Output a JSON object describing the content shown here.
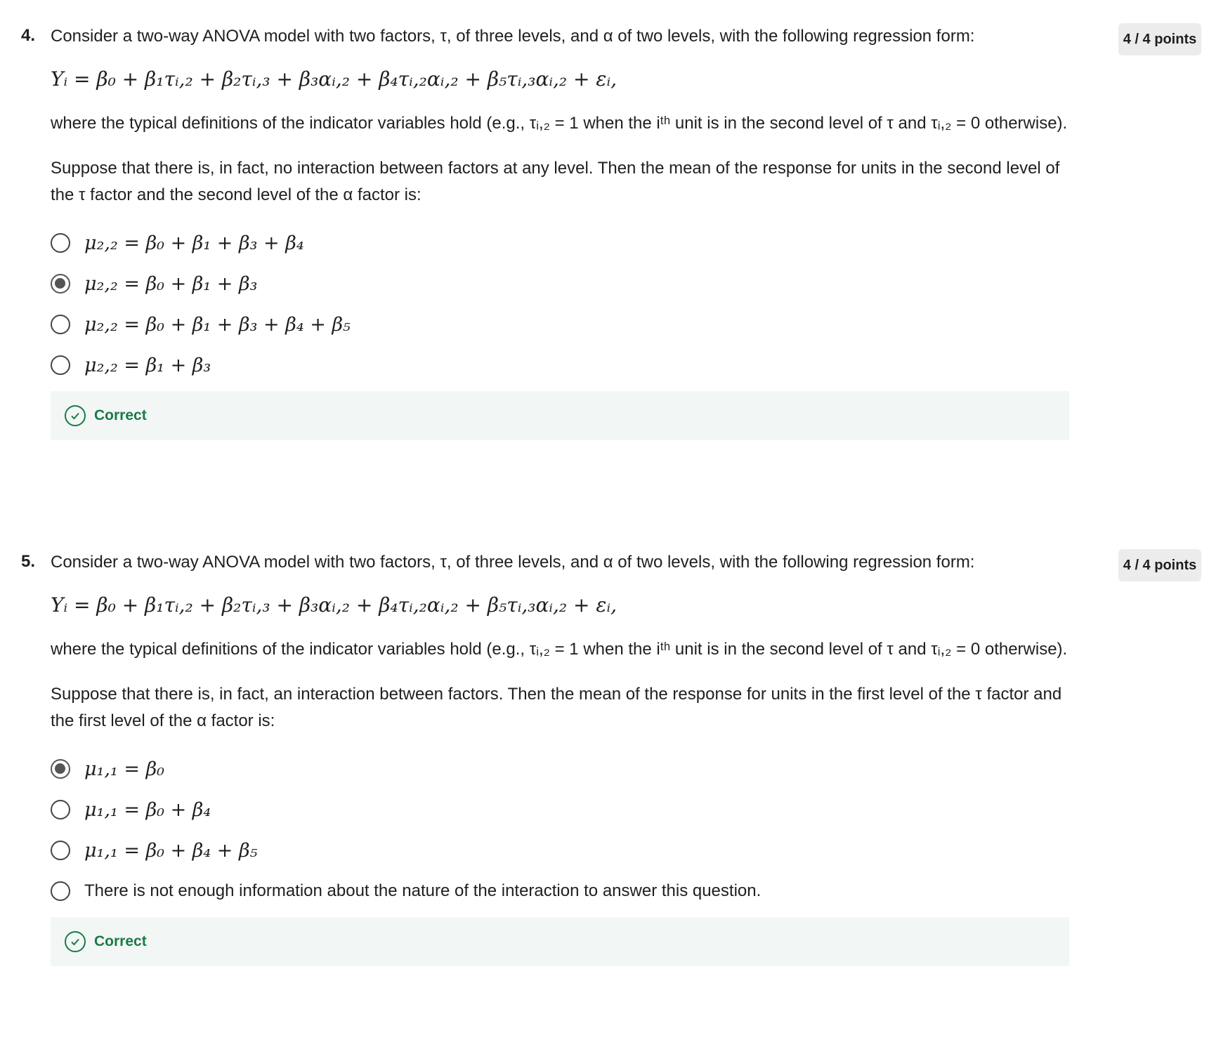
{
  "questions": [
    {
      "number": "4.",
      "points": "4 / 4 points",
      "prompt": "Consider a two-way ANOVA model with two factors, τ, of three levels, and α of two levels, with the following regression form:",
      "equation": "Yᵢ = β₀ + β₁τᵢ,₂ + β₂τᵢ,₃ + β₃αᵢ,₂ + β₄τᵢ,₂αᵢ,₂ + β₅τᵢ,₃αᵢ,₂ + εᵢ,",
      "definition": "where the typical definitions of the indicator variables hold (e.g., τᵢ,₂ = 1 when the iᵗʰ unit is in the second level of τ and τᵢ,₂ = 0 otherwise).",
      "scenario": "Suppose that there is, in fact, no interaction between factors at any level. Then the mean of the response for units in the second level of the τ factor and the second level of the α factor is:",
      "options": [
        {
          "label": "μ₂,₂ = β₀ + β₁ + β₃ + β₄",
          "checked": false
        },
        {
          "label": "μ₂,₂ = β₀ + β₁ + β₃",
          "checked": true
        },
        {
          "label": "μ₂,₂ = β₀ + β₁ + β₃ + β₄ + β₅",
          "checked": false
        },
        {
          "label": "μ₂,₂ = β₁ + β₃",
          "checked": false
        }
      ],
      "feedback": "Correct"
    },
    {
      "number": "5.",
      "points": "4 / 4 points",
      "prompt": "Consider a two-way ANOVA model with two factors, τ, of three levels, and α of two levels, with the following regression form:",
      "equation": "Yᵢ = β₀ + β₁τᵢ,₂ + β₂τᵢ,₃ + β₃αᵢ,₂ + β₄τᵢ,₂αᵢ,₂ + β₅τᵢ,₃αᵢ,₂ + εᵢ,",
      "definition": "where the typical definitions of the indicator variables hold (e.g., τᵢ,₂ = 1 when the iᵗʰ unit is in the second level of τ and τᵢ,₂ = 0 otherwise).",
      "scenario": "Suppose that there is, in fact, an interaction between factors. Then the mean of the response for units in the first level of the τ factor and the first level of the α factor is:",
      "options": [
        {
          "label": "μ₁,₁ = β₀",
          "checked": true
        },
        {
          "label": "μ₁,₁ = β₀ + β₄",
          "checked": false
        },
        {
          "label": "μ₁,₁ = β₀ + β₄ + β₅",
          "checked": false
        },
        {
          "label": "There is not enough information about the nature of the interaction to answer this question.",
          "checked": false
        }
      ],
      "feedback": "Correct"
    }
  ],
  "colors": {
    "correct_green": "#1b7a46",
    "feedback_bg": "#f2f7f5",
    "points_bg": "#ececec"
  }
}
